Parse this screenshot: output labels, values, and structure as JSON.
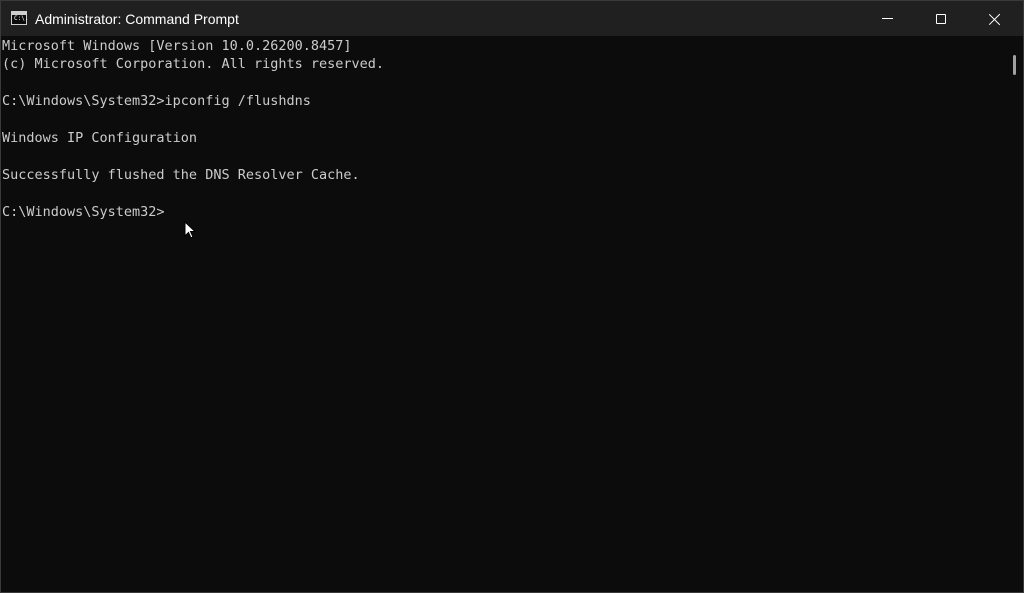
{
  "window": {
    "title": "Administrator: Command Prompt",
    "icon": "command-prompt-icon",
    "app_icon_glyph": "C:\\.",
    "controls": [
      "minimize-icon",
      "maximize-icon",
      "close-icon"
    ]
  },
  "console": {
    "lines": [
      "Microsoft Windows [Version 10.0.26200.8457]",
      "(c) Microsoft Corporation. All rights reserved.",
      "",
      "C:\\Windows\\System32>ipconfig /flushdns",
      "",
      "Windows IP Configuration",
      "",
      "Successfully flushed the DNS Resolver Cache.",
      "",
      "C:\\Windows\\System32>"
    ]
  },
  "colors": {
    "background": "#0c0c0c",
    "titlebar": "#202020",
    "text": "#cccccc"
  }
}
